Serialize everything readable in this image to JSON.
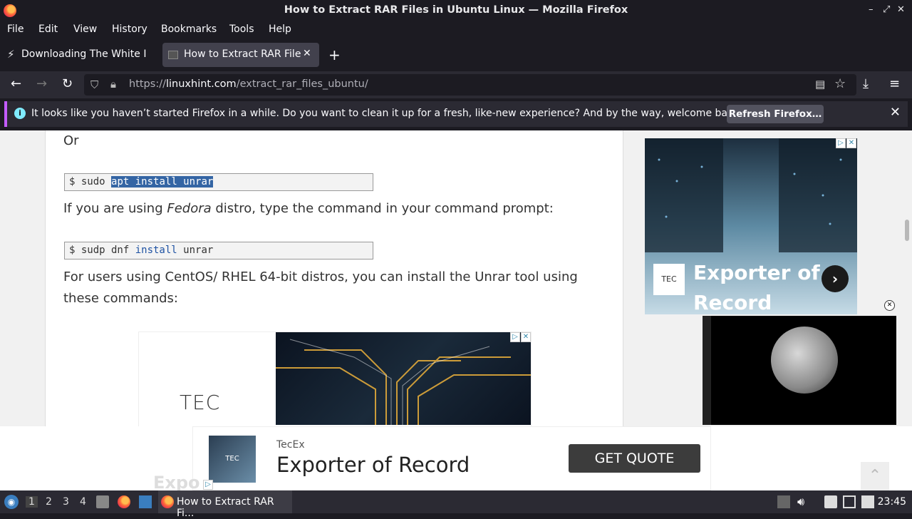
{
  "window": {
    "title": "How to Extract RAR Files in Ubuntu Linux — Mozilla Firefox",
    "controls": [
      "–",
      "⤢",
      "✕"
    ]
  },
  "menu": [
    "File",
    "Edit",
    "View",
    "History",
    "Bookmarks",
    "Tools",
    "Help"
  ],
  "tabs": [
    {
      "label": "Downloading The White I"
    },
    {
      "label": "How to Extract RAR Files"
    }
  ],
  "new_tab": "+",
  "url": {
    "prefix": "https://",
    "host": "linuxhint.com",
    "path": "/extract_rar_files_ubuntu/"
  },
  "notification": {
    "message": "It looks like you haven’t started Firefox in a while. Do you want to clean it up for a fresh, like-new experience? And by the way, welcome back!",
    "button": "Refresh Firefox…"
  },
  "article": {
    "or": "Or",
    "cmd1": {
      "prompt": "$ sudo ",
      "kw": "apt",
      "rest": " install unrar"
    },
    "fedora": {
      "pre": "If you are using ",
      "em": "Fedora",
      "post": " distro, type the command in your command prompt:"
    },
    "cmd2": {
      "prompt": "$ sudp dnf ",
      "kw": "install",
      "rest": " unrar"
    },
    "centos": "For users using CentOS/ RHEL 64-bit distros, you can install the Unrar tool using these commands:"
  },
  "ads": {
    "inline_logo": "TEC",
    "right_headline1": "Exporter of",
    "right_headline2": "Record",
    "right_logo": "TEC",
    "bottom_brand": "TecEx",
    "bottom_headline": "Exporter of Record",
    "bottom_cta": "GET QUOTE",
    "bottom_thumb": "TEC",
    "ghost_text": "Expo"
  },
  "taskbar": {
    "workspaces": [
      "1",
      "2",
      "3",
      "4"
    ],
    "task_label": "How to Extract RAR Fi...",
    "clock": "23:45"
  },
  "colors": {
    "accent": "#c45cff",
    "info": "#80ebff",
    "code_kw": "#1e52a3",
    "selection": "#3465a4"
  }
}
